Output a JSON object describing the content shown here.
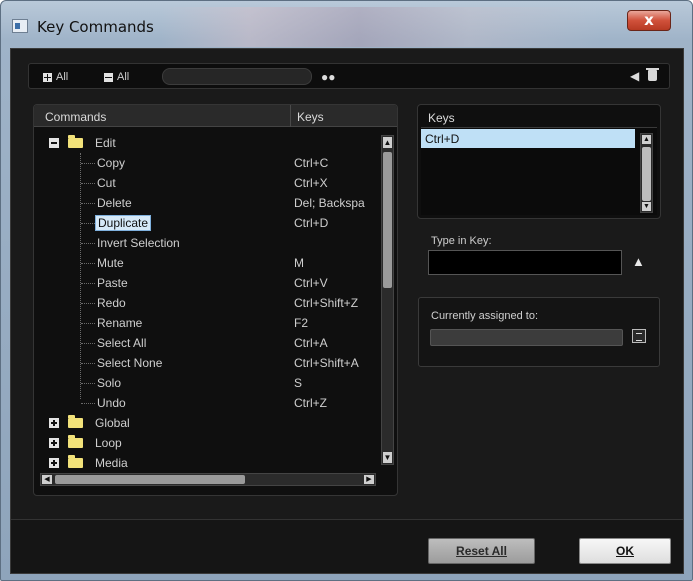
{
  "window": {
    "title": "Key Commands",
    "close_symbol": "x"
  },
  "toolbar": {
    "expand_all_label": "All",
    "collapse_all_label": "All",
    "search_placeholder": ""
  },
  "commands": {
    "header_commands": "Commands",
    "header_keys": "Keys",
    "edit_folder": "Edit",
    "items": [
      {
        "label": "Copy",
        "key": "Ctrl+C"
      },
      {
        "label": "Cut",
        "key": "Ctrl+X"
      },
      {
        "label": "Delete",
        "key": "Del; Backspa"
      },
      {
        "label": "Duplicate",
        "key": "Ctrl+D"
      },
      {
        "label": "Invert Selection",
        "key": ""
      },
      {
        "label": "Mute",
        "key": "M"
      },
      {
        "label": "Paste",
        "key": "Ctrl+V"
      },
      {
        "label": "Redo",
        "key": "Ctrl+Shift+Z"
      },
      {
        "label": "Rename",
        "key": "F2"
      },
      {
        "label": "Select All",
        "key": "Ctrl+A"
      },
      {
        "label": "Select None",
        "key": "Ctrl+Shift+A"
      },
      {
        "label": "Solo",
        "key": "S"
      },
      {
        "label": "Undo",
        "key": "Ctrl+Z"
      }
    ],
    "folders": [
      "Global",
      "Loop",
      "Media"
    ]
  },
  "keys_panel": {
    "title": "Keys",
    "selected": "Ctrl+D"
  },
  "type_in_key": {
    "label": "Type in Key:",
    "value": ""
  },
  "assigned": {
    "label": "Currently assigned to:",
    "value": ""
  },
  "buttons": {
    "reset_all": "Reset All",
    "ok": "OK"
  }
}
